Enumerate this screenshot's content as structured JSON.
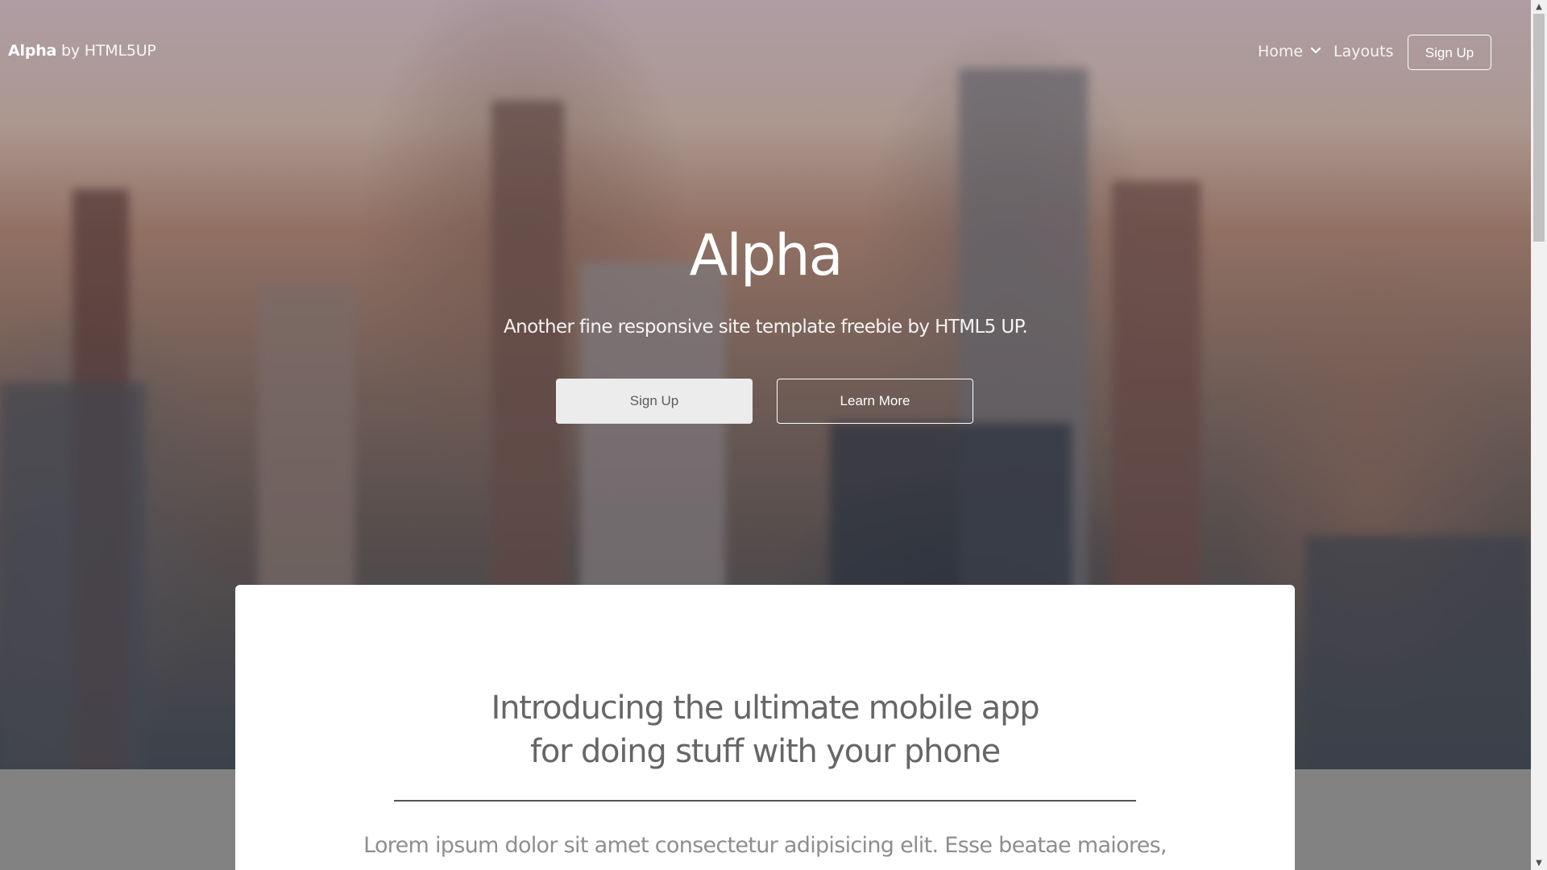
{
  "header": {
    "logo_strong": "Alpha",
    "logo_rest": " by HTML5UP",
    "nav": {
      "home": "Home",
      "home_icon": "chevron-down-icon",
      "layouts": "Layouts",
      "signup": "Sign Up"
    }
  },
  "hero": {
    "title": "Alpha",
    "subtitle": "Another fine responsive site template freebie by HTML5 UP.",
    "signup_label": "Sign Up",
    "learn_more_label": "Learn More"
  },
  "content": {
    "heading_line1": "Introducing the ultimate mobile app",
    "heading_line2": "for doing stuff with your phone",
    "body": "Lorem ipsum dolor sit amet consectetur adipisicing elit. Esse beatae maiores,"
  },
  "scrollbar": {
    "up_icon": "triangle-up-icon",
    "down_icon": "triangle-down-icon"
  },
  "colors": {
    "band": "#828282",
    "card": "#ffffff",
    "button_light": "#ececec"
  }
}
